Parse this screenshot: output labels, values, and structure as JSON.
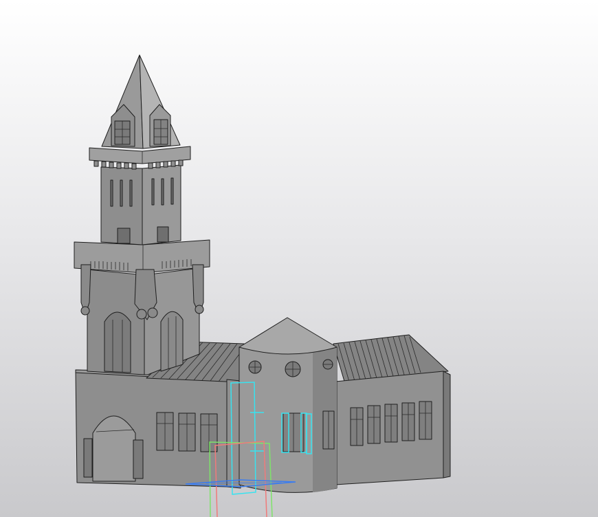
{
  "scene": {
    "model": "tower-building",
    "colors": {
      "background_top": "#ffffff",
      "background_bottom": "#c9c9cc",
      "body_face": "#8a8a8a",
      "body_dark": "#6e6e6e",
      "body_light": "#a3a3a3",
      "roof": "#7d7d7d",
      "edge": "#1e1e1e",
      "selection_cyan": "#37e3f0",
      "selection_green": "#7ee36a",
      "selection_red": "#f07a7a",
      "selection_blue": "#3a7cf0"
    }
  }
}
